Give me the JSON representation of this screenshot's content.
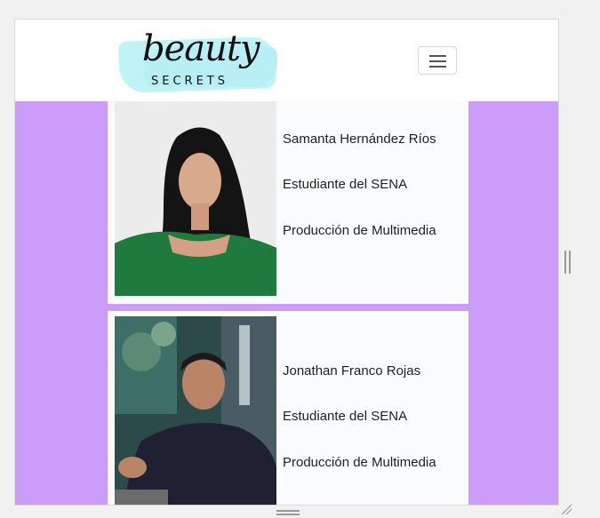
{
  "logo": {
    "script_text": "beauty",
    "caps_text": "SECRETS"
  },
  "navbar": {
    "toggle_icon": "hamburger-menu-icon"
  },
  "colors": {
    "background": "#cc9df8",
    "card": "#fafbfd",
    "logo_splash": "#bff3f6"
  },
  "profiles": [
    {
      "name": "Samanta Hernández Ríos",
      "role": "Estudiante del SENA",
      "program": "Producción de Multimedia",
      "photo_icon": "profile-photo-woman"
    },
    {
      "name": "Jonathan Franco Rojas",
      "role": "Estudiante del SENA",
      "program": "Producción de Multimedia",
      "photo_icon": "profile-photo-man"
    }
  ]
}
